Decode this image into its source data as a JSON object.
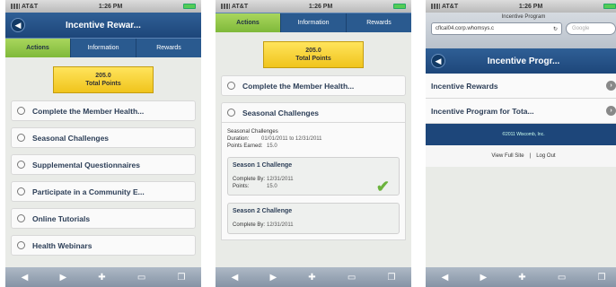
{
  "status": {
    "carrier": "AT&T",
    "time": "1:26 PM"
  },
  "phone1": {
    "header_title": "Incentive Rewar...",
    "tabs": [
      "Actions",
      "Information",
      "Rewards"
    ],
    "points": {
      "value": "205.0",
      "label": "Total Points"
    },
    "items": [
      "Complete the Member Health...",
      "Seasonal Challenges",
      "Supplemental Questionnaires",
      "Participate in a Community E...",
      "Online Tutorials",
      "Health Webinars"
    ]
  },
  "phone2": {
    "tabs": [
      "Actions",
      "Information",
      "Rewards"
    ],
    "points": {
      "value": "205.0",
      "label": "Total Points"
    },
    "items": [
      "Complete the Member Health...",
      "Seasonal Challenges"
    ],
    "detail": {
      "heading": "Seasonal Challenges",
      "duration_label": "Duration:",
      "duration_value": "01/01/2011 to 12/31/2011",
      "points_label": "Points Earned:",
      "points_value": "15.0"
    },
    "challenges": [
      {
        "title": "Season 1 Challenge",
        "complete_label": "Complete By:",
        "complete_value": "12/31/2011",
        "points_label": "Points:",
        "points_value": "15.0"
      },
      {
        "title": "Season 2 Challenge",
        "complete_label": "Complete By:",
        "complete_value": "12/31/2011"
      }
    ]
  },
  "phone3": {
    "url_title": "Incentive Program",
    "url": "cflcal04.corp.whomsys.c",
    "search_placeholder": "Google",
    "header_title": "Incentive Progr...",
    "items": [
      "Incentive Rewards",
      "Incentive Program for Tota..."
    ],
    "footer": "©2011 Wiscomb, Inc.",
    "links": [
      "View Full Site",
      "Log Out"
    ]
  }
}
